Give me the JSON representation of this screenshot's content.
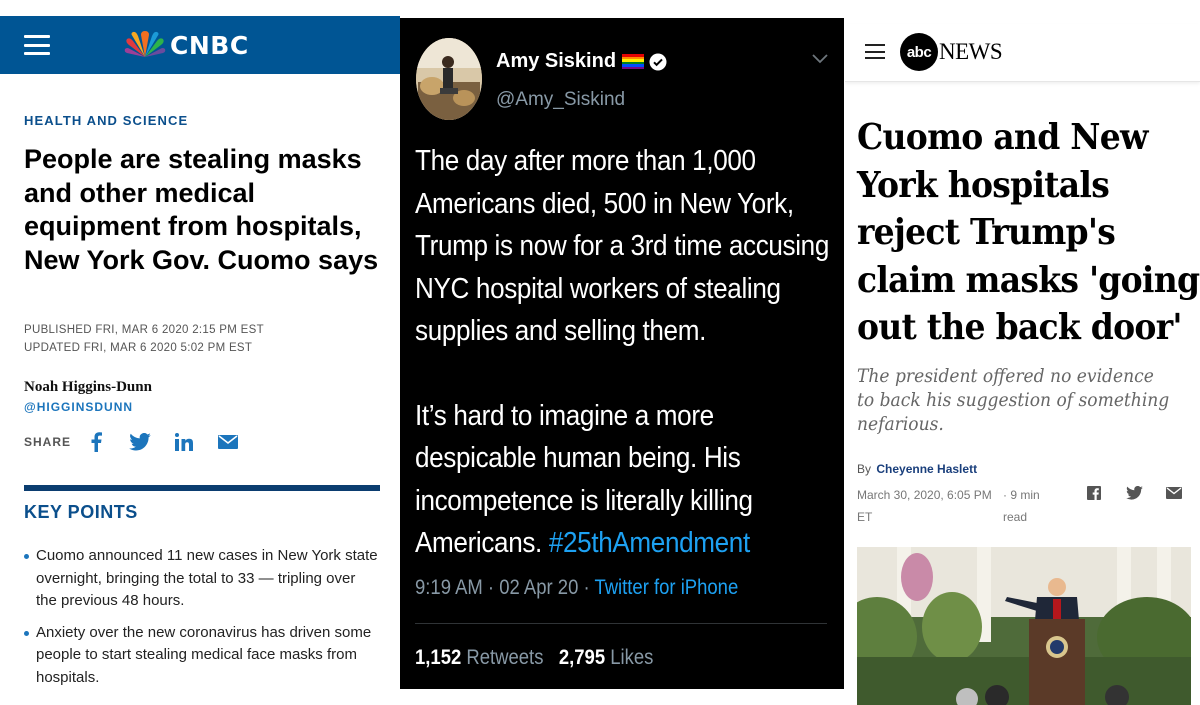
{
  "cnbc": {
    "logo_text": "CNBC",
    "section": "HEALTH AND SCIENCE",
    "headline": "People are stealing masks and other medical equipment from hospitals, New York Gov. Cuomo says",
    "published": "PUBLISHED FRI, MAR 6 2020 2:15 PM EST",
    "updated": "UPDATED FRI, MAR 6 2020 5:02 PM EST",
    "author": "Noah Higgins-Dunn",
    "handle": "@HIGGINSDUNN",
    "share_label": "SHARE",
    "share_icons": [
      "facebook-icon",
      "twitter-icon",
      "linkedin-icon",
      "email-icon"
    ],
    "key_points_title": "KEY POINTS",
    "key_points": [
      "Cuomo announced 11 new cases in New York state overnight, bringing the total to 33 — tripling over the previous 48 hours.",
      "Anxiety over the new coronavirus has driven some people to start stealing medical face masks from hospitals."
    ],
    "colors": {
      "header": "#005594",
      "accent": "#1c75bc"
    }
  },
  "tweet": {
    "name": "Amy Siskind",
    "handle": "@Amy_Siskind",
    "paragraph1": "The day after more than 1,000 Americans died, 500 in New York, Trump is now for a 3rd time accusing NYC hospital workers of stealing supplies and selling them.",
    "paragraph2_text": "It’s hard to imagine a more despicable human being. His incompetence is literally killing Americans.",
    "hashtag": "#25thAmendment",
    "time": "9:19 AM · 02 Apr 20 · ",
    "source": "Twitter for iPhone",
    "retweets_count": "1,152",
    "retweets_label": "Retweets",
    "likes_count": "2,795",
    "likes_label": "Likes",
    "colors": {
      "background": "#000000",
      "link": "#1da1f2",
      "muted": "#8899a6"
    }
  },
  "abc": {
    "logo_circle": "abc",
    "logo_text": "NEWS",
    "headline": "Cuomo and New York hospitals reject Trump's claim masks 'going out the back door'",
    "dek": "The president offered no evidence to back his suggestion of something nefarious.",
    "by_label": "By",
    "author": "Cheyenne Haslett",
    "date": "March 30, 2020, 6:05 PM ET",
    "read_time": "· 9 min read",
    "share_icons": [
      "facebook-icon",
      "twitter-icon",
      "email-icon"
    ]
  }
}
